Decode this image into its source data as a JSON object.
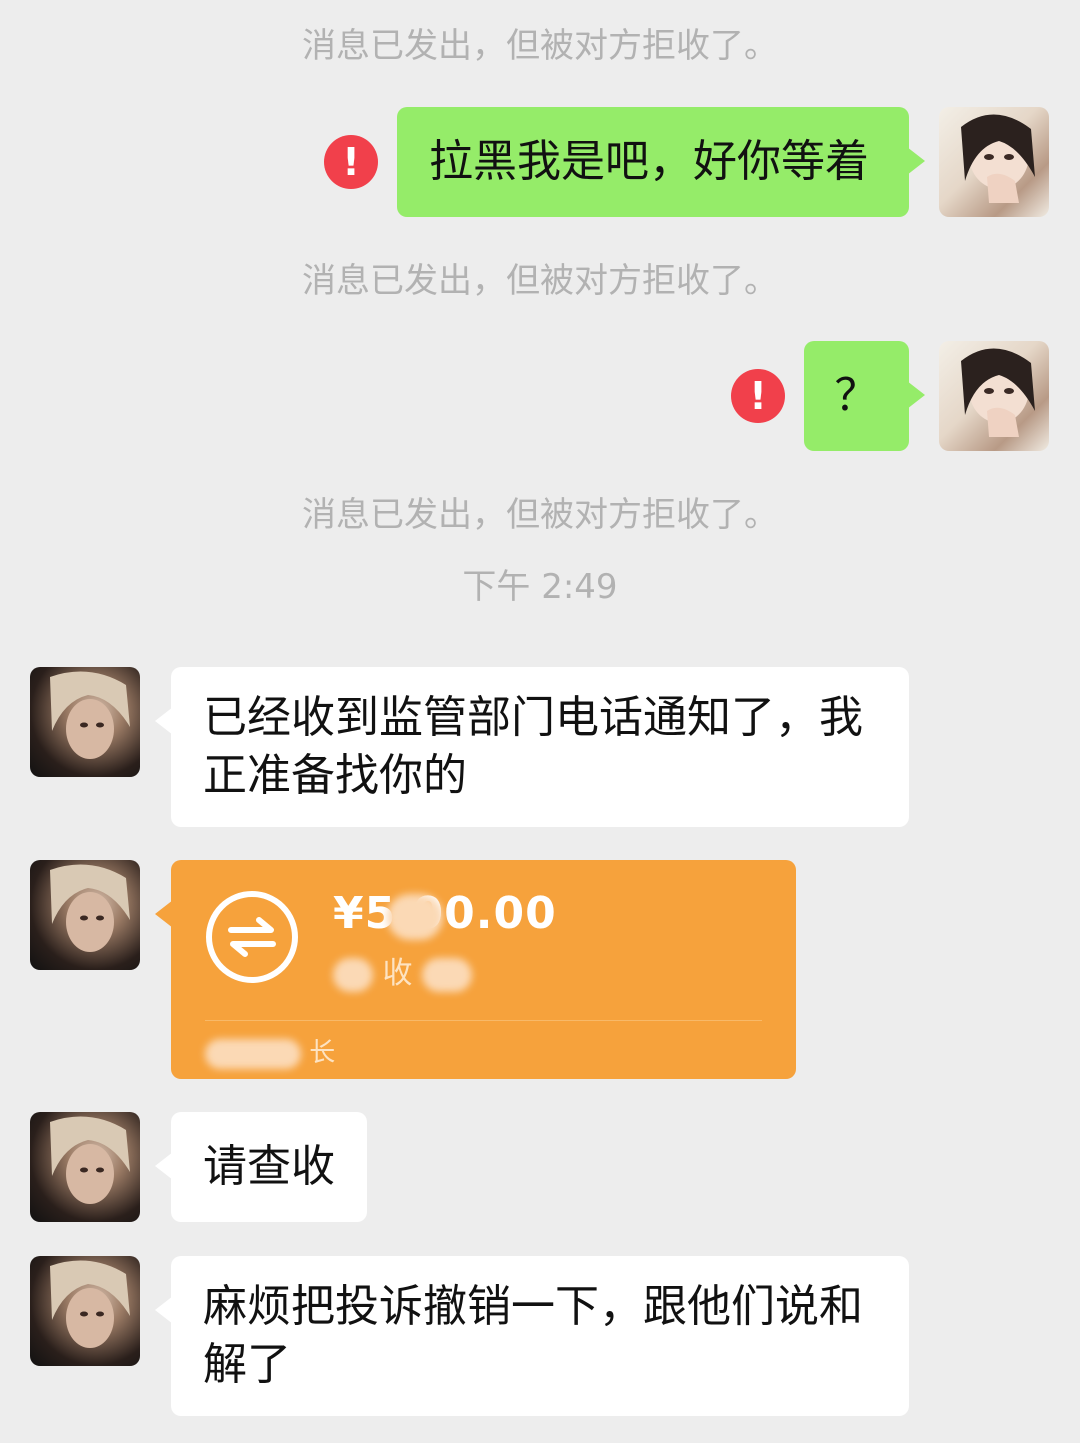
{
  "system_notices": {
    "rejected_1": "消息已发出，但被对方拒收了。",
    "rejected_2": "消息已发出，但被对方拒收了。",
    "rejected_3": "消息已发出，但被对方拒收了。"
  },
  "timestamp": "下午 2:49",
  "messages": {
    "sent_1": "拉黑我是吧，好你等着",
    "sent_2": "？",
    "recv_1": "已经收到监管部门电话通知了，我正准备找你的",
    "recv_2": "请查收",
    "recv_3": "麻烦把投诉撤销一下，跟他们说和解了"
  },
  "error_icon": "!",
  "transfer": {
    "amount": "¥5  00.00",
    "status": "收",
    "label": "长",
    "icon": "transfer-arrows-icon"
  },
  "colors": {
    "sent_bubble": "#95ec69",
    "received_bubble": "#ffffff",
    "transfer_card": "#f6a23c",
    "error": "#f1404b",
    "background": "#ededed"
  }
}
